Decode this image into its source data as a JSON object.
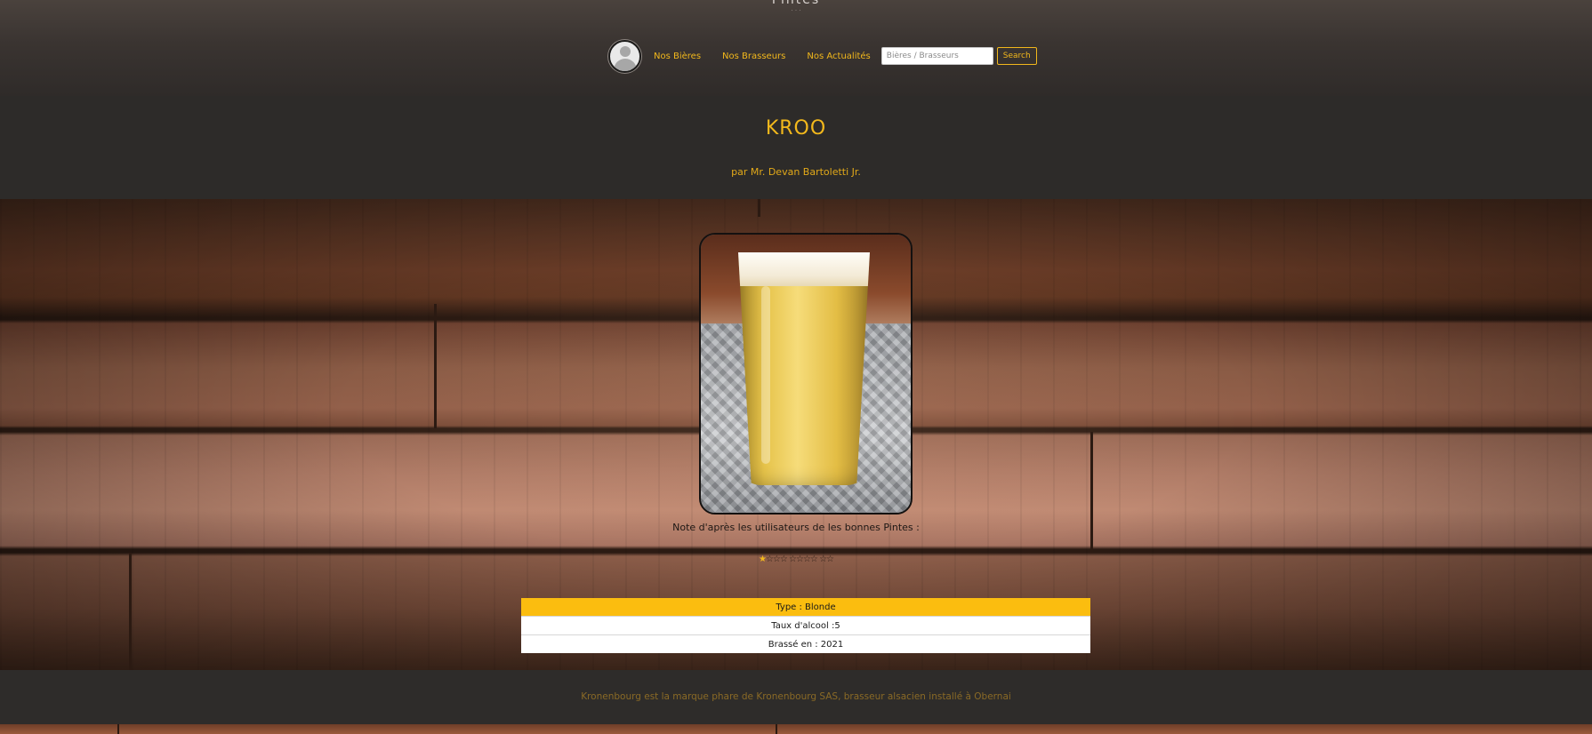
{
  "header": {
    "logo_text": "Pintes",
    "logo_sub": "· · ·",
    "nav": [
      {
        "label": "Nos Bières"
      },
      {
        "label": "Nos Brasseurs"
      },
      {
        "label": "Nos Actualités"
      }
    ],
    "search": {
      "placeholder": "Bières / Brasseurs",
      "value": "",
      "button_label": "Search"
    }
  },
  "beer": {
    "title": "KROO",
    "author": "par Mr. Devan Bartoletti Jr.",
    "photo_alt": "beer-glass-photo"
  },
  "rating": {
    "label": "Note d'après les utilisateurs de les bonnes Pintes :",
    "value": 0,
    "max": 5,
    "first_star": "★",
    "empty_stars": "☆☆☆ ☆☆☆☆ ☆☆"
  },
  "details": {
    "type": "Type : Blonde",
    "alcohol": "Taux d'alcool :5",
    "brewed": "Brassé en : 2021"
  },
  "footer": {
    "text": "Kronenbourg est la marque phare de Kronenbourg SAS, brasseur alsacien installé à Obernai"
  },
  "colors": {
    "accent": "#f2b81c",
    "header_bg": "#3a3431",
    "table_highlight": "#fbbd0f"
  }
}
